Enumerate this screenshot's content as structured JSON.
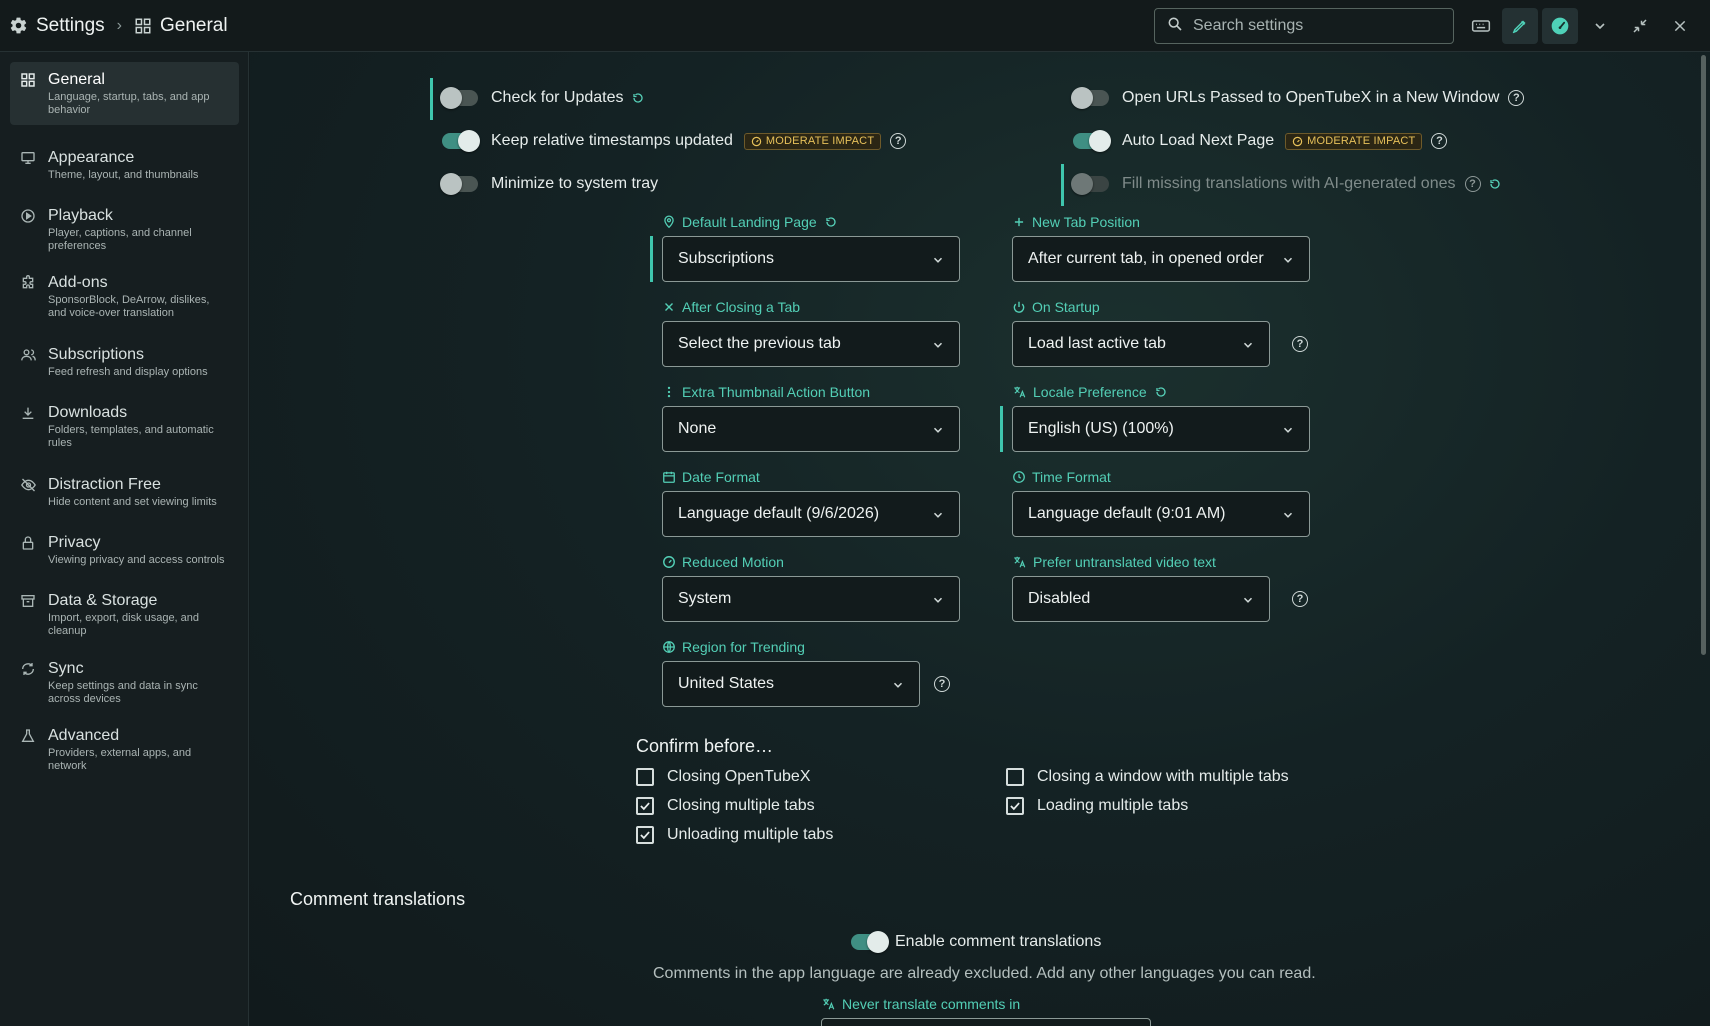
{
  "header": {
    "settings_title": "Settings",
    "page_title": "General",
    "search_placeholder": "Search settings"
  },
  "sidebar": {
    "items": [
      {
        "label": "General",
        "desc": "Language, startup, tabs, and app behavior",
        "active": true
      },
      {
        "label": "Appearance",
        "desc": "Theme, layout, and thumbnails"
      },
      {
        "label": "Playback",
        "desc": "Player, captions, and channel preferences"
      },
      {
        "label": "Add-ons",
        "desc": "SponsorBlock, DeArrow, dislikes, and voice-over translation"
      },
      {
        "label": "Subscriptions",
        "desc": "Feed refresh and display options"
      },
      {
        "label": "Downloads",
        "desc": "Folders, templates, and automatic rules"
      },
      {
        "label": "Distraction Free",
        "desc": "Hide content and set viewing limits"
      },
      {
        "label": "Privacy",
        "desc": "Viewing privacy and access controls"
      },
      {
        "label": "Data & Storage",
        "desc": "Import, export, disk usage, and cleanup"
      },
      {
        "label": "Sync",
        "desc": "Keep settings and data in sync across devices"
      },
      {
        "label": "Advanced",
        "desc": "Providers, external apps, and network"
      }
    ]
  },
  "toggles": {
    "check_updates": {
      "label": "Check for Updates",
      "on": false
    },
    "keep_timestamps": {
      "label": "Keep relative timestamps updated",
      "on": true,
      "badge": "MODERATE IMPACT"
    },
    "minimize_tray": {
      "label": "Minimize to system tray",
      "on": false
    },
    "open_urls": {
      "label": "Open URLs Passed to OpenTubeX in a New Window",
      "on": false
    },
    "auto_load": {
      "label": "Auto Load Next Page",
      "on": true,
      "badge": "MODERATE IMPACT"
    },
    "fill_translations": {
      "label": "Fill missing translations with AI-generated ones",
      "on": false,
      "disabled": true
    }
  },
  "fields": {
    "default_landing": {
      "label": "Default Landing Page",
      "value": "Subscriptions"
    },
    "new_tab_position": {
      "label": "New Tab Position",
      "value": "After current tab, in opened order"
    },
    "after_closing": {
      "label": "After Closing a Tab",
      "value": "Select the previous tab"
    },
    "on_startup": {
      "label": "On Startup",
      "value": "Load last active tab"
    },
    "extra_thumb": {
      "label": "Extra Thumbnail Action Button",
      "value": "None"
    },
    "locale": {
      "label": "Locale Preference",
      "value": "English (US) (100%)"
    },
    "date_format": {
      "label": "Date Format",
      "value": "Language default (9/6/2026)"
    },
    "time_format": {
      "label": "Time Format",
      "value": "Language default (9:01 AM)"
    },
    "reduced_motion": {
      "label": "Reduced Motion",
      "value": "System"
    },
    "untranslated": {
      "label": "Prefer untranslated video text",
      "value": "Disabled"
    },
    "region": {
      "label": "Region for Trending",
      "value": "United States"
    }
  },
  "confirm": {
    "title": "Confirm before…",
    "items": [
      {
        "label": "Closing OpenTubeX",
        "checked": false
      },
      {
        "label": "Closing a window with multiple tabs",
        "checked": false
      },
      {
        "label": "Closing multiple tabs",
        "checked": true
      },
      {
        "label": "Loading multiple tabs",
        "checked": true
      },
      {
        "label": "Unloading multiple tabs",
        "checked": true
      }
    ]
  },
  "comments": {
    "title": "Comment translations",
    "enable_label": "Enable comment translations",
    "enable_on": true,
    "desc": "Comments in the app language are already excluded. Add any other languages you can read.",
    "never_label": "Never translate comments in"
  },
  "colors": {
    "accent": "#53cfb6",
    "badge": "#e7c15a",
    "background": "#121a1c"
  }
}
